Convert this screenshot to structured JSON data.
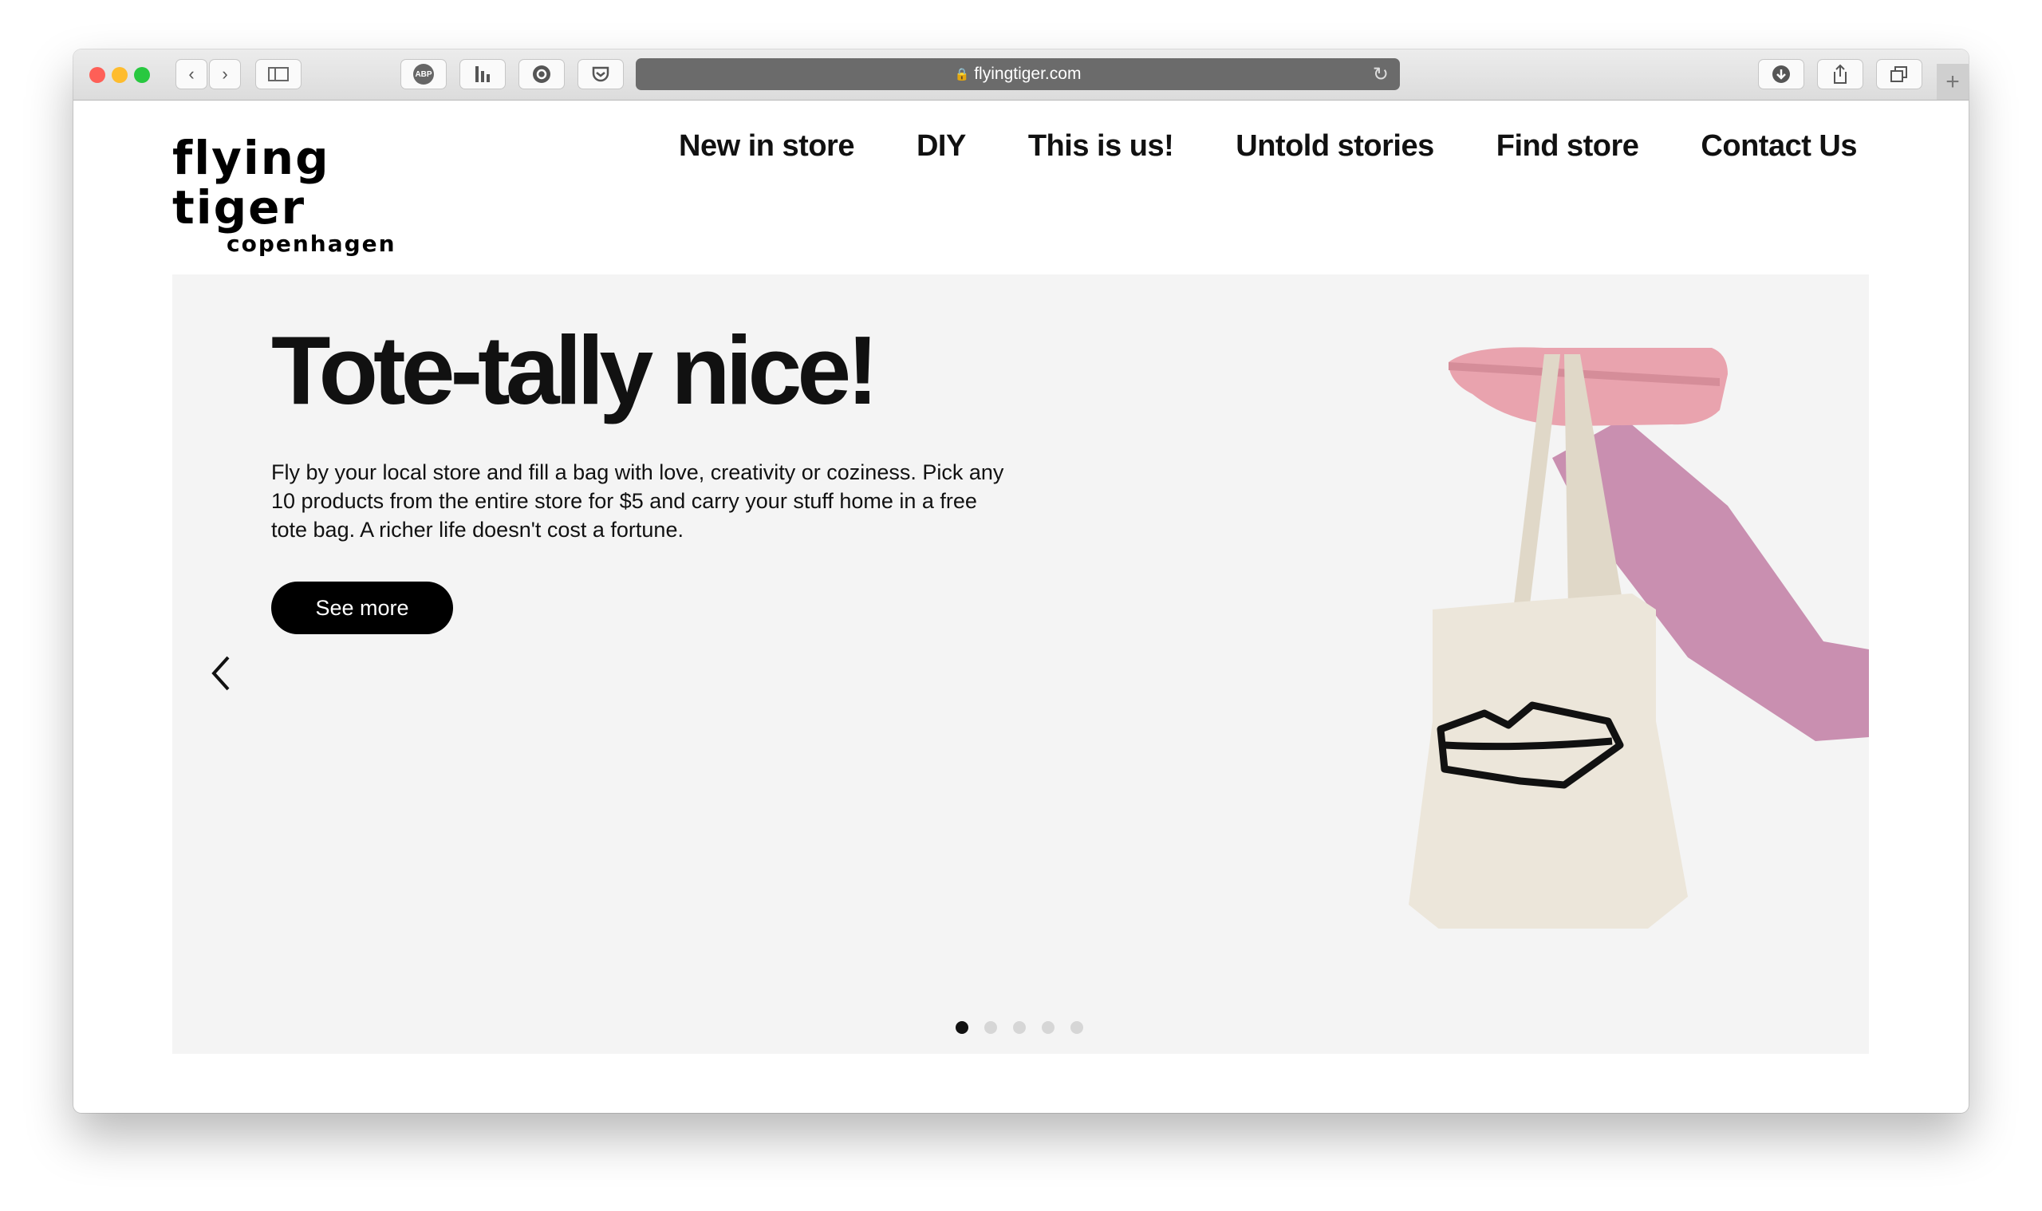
{
  "browser": {
    "url": "flyingtiger.com",
    "toolbar_icons": [
      "back-icon",
      "forward-icon",
      "sidebar-icon",
      "adblock-icon",
      "extension-icon",
      "grammarly-icon",
      "pocket-icon",
      "download-icon",
      "share-icon",
      "tabs-icon",
      "new-tab-icon"
    ],
    "abp_label": "ABP",
    "new_tab_label": "+"
  },
  "logo": {
    "main": "flying tiger",
    "sub": "copenhagen"
  },
  "nav": {
    "items": [
      {
        "label": "New in store"
      },
      {
        "label": "DIY"
      },
      {
        "label": "This is us!"
      },
      {
        "label": "Untold stories"
      },
      {
        "label": "Find store"
      },
      {
        "label": "Contact Us"
      }
    ]
  },
  "hero": {
    "title": "Tote-tally nice!",
    "text": "Fly by your local store and fill a bag with love, creativity or coziness. Pick any 10 products from the entire store for $5 and carry your stuff home in a free tote bag. A richer life doesn't cost a fortune.",
    "button": "See more",
    "slide_count": 5,
    "active_slide": 1
  },
  "colors": {
    "hero_bg": "#f4f4f4",
    "button_bg": "#000000",
    "leg": "#c98fb0",
    "shoe": "#e9a3ae",
    "tote": "#ece6da"
  }
}
